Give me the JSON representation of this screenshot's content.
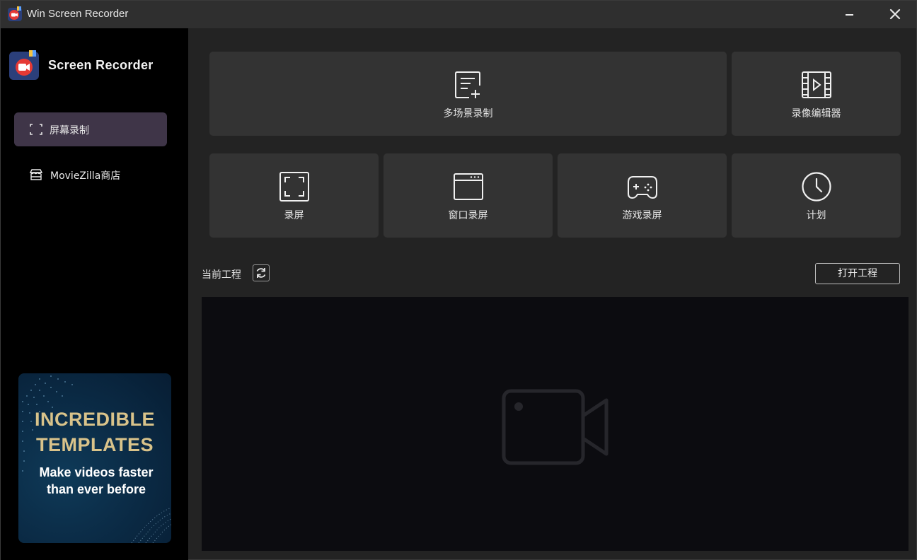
{
  "window": {
    "title": "Win Screen Recorder",
    "minimize_icon": "minimize-icon",
    "close_icon": "close-icon"
  },
  "sidebar": {
    "brand": "Screen Recorder",
    "items": [
      {
        "label": "屏幕录制",
        "icon": "screen-capture-icon",
        "active": true
      },
      {
        "label": "MovieZilla商店",
        "icon": "store-icon",
        "active": false
      }
    ],
    "promo": {
      "title_line1": "INCREDIBLE",
      "title_line2": "TEMPLATES",
      "subtitle_line1": "Make videos faster",
      "subtitle_line2": "than ever before"
    }
  },
  "tiles": {
    "multi_scene": {
      "label": "多场景录制",
      "icon": "add-scene-icon"
    },
    "video_editor": {
      "label": "录像编辑器",
      "icon": "film-icon"
    },
    "record_screen": {
      "label": "录屏",
      "icon": "fullscreen-icon"
    },
    "window_record": {
      "label": "窗口录屏",
      "icon": "window-icon"
    },
    "game_record": {
      "label": "游戏录屏",
      "icon": "gamepad-icon"
    },
    "schedule": {
      "label": "计划",
      "icon": "clock-icon"
    }
  },
  "projects": {
    "label": "当前工程",
    "refresh_icon": "refresh-icon",
    "open_button": "打开工程",
    "empty_icon": "video-camera-icon"
  },
  "colors": {
    "sidebar_bg": "#000000",
    "main_bg": "#232323",
    "tile_bg": "#333333",
    "active_nav_bg": "#3f3548",
    "accent_red": "#e53935",
    "promo_gold": "#d9c38a"
  }
}
